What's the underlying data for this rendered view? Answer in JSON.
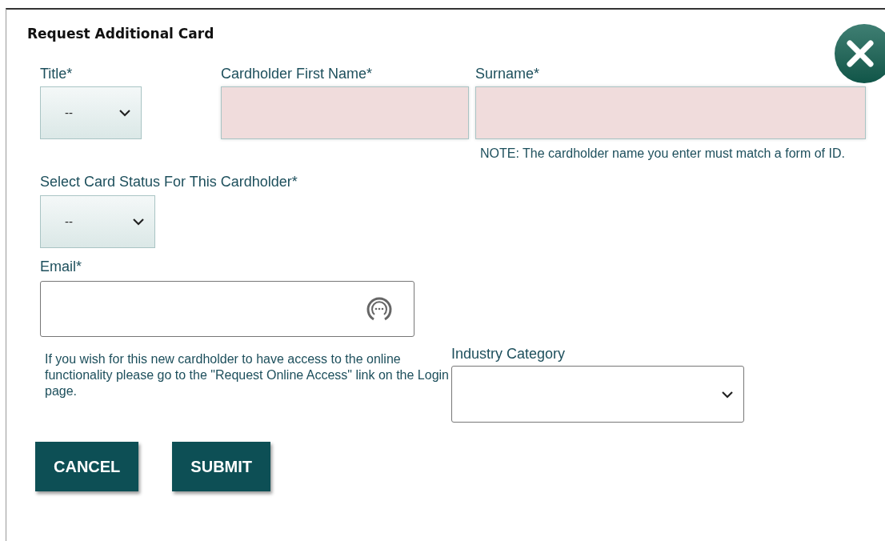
{
  "dialog": {
    "title": "Request Additional Card",
    "fields": [
      {
        "kind": "select",
        "label": "Title*",
        "value": "--",
        "invalid": false
      },
      {
        "kind": "text",
        "label": "Cardholder First Name*",
        "invalid": true
      },
      {
        "kind": "text",
        "label": "Surname*",
        "invalid": true,
        "note": "NOTE: The cardholder name you enter must match a form of ID."
      },
      {
        "kind": "select",
        "label": "Select Card Status For This Cardholder*",
        "value": "--",
        "invalid": false
      },
      {
        "kind": "email",
        "label": "Email*",
        "invalid": false
      },
      {
        "kind": "plain-select",
        "label": "Industry Category",
        "invalid": false
      }
    ],
    "help_text": "If you wish for this new cardholder to have access to the online functionality please go to the \"Request Online Access\" link on the Login page.",
    "buttons": [
      "CANCEL",
      "SUBMIT"
    ]
  }
}
